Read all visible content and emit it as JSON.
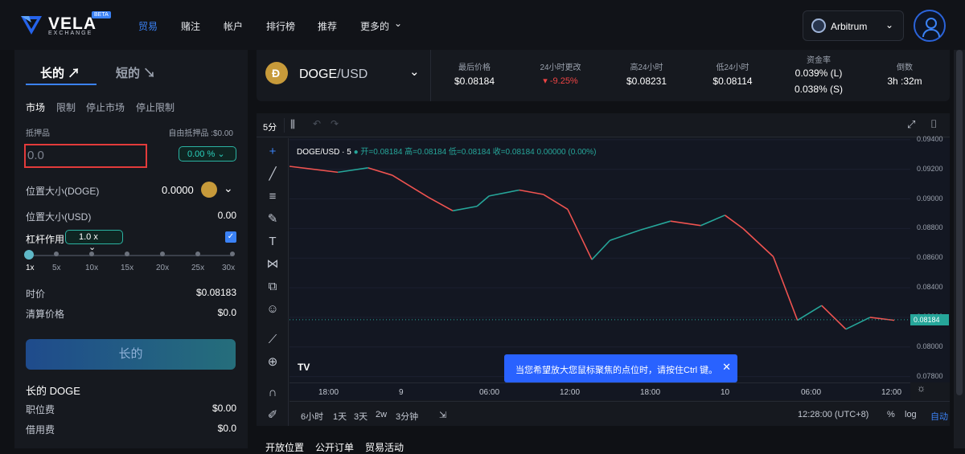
{
  "brand": {
    "name": "VELA",
    "sub": "EXCHANGE",
    "badge": "BETA"
  },
  "nav": [
    "贸易",
    "赌注",
    "帐户",
    "排行榜",
    "推荐",
    "更多的"
  ],
  "network": {
    "label": "Arbitrum"
  },
  "order": {
    "tab_long": "长的",
    "tab_short": "短的",
    "types": [
      "市场",
      "限制",
      "停止市场",
      "停止限制"
    ],
    "collateral_label": "抵押品",
    "free_collateral": "自由抵押品 :$0.00",
    "amount_placeholder": "0.0",
    "pct_value": "0.00 %",
    "pos_size_label": "位置大小(DOGE)",
    "pos_size_value": "0.0000",
    "pos_usd_label": "位置大小(USD)",
    "pos_usd_value": "0.00",
    "leverage_label": "杠杆作用",
    "leverage_value": "1.0 x",
    "leverage_ticks": [
      "1x",
      "5x",
      "10x",
      "15x",
      "20x",
      "25x",
      "30x"
    ],
    "price_label": "时价",
    "price_value": "$0.08183",
    "liq_label": "清算价格",
    "liq_value": "$0.0",
    "submit_label": "长的",
    "summary_title": "长的 DOGE",
    "fee1_label": "职位费",
    "fee1_value": "$0.00",
    "fee2_label": "借用费",
    "fee2_value": "$0.0"
  },
  "market": {
    "pair_base": "DOGE",
    "pair_quote": "/USD",
    "stats": [
      {
        "label": "最后价格",
        "value": "$0.08184"
      },
      {
        "label": "24小时更改",
        "value": "▾ -9.25%"
      },
      {
        "label": "高24小时",
        "value": "$0.08231"
      },
      {
        "label": "低24小时",
        "value": "$0.08114"
      },
      {
        "label": "资金率",
        "value": "0.039% (L)",
        "value2": "0.038% (S)"
      },
      {
        "label": "倒数",
        "value": "3h :32m"
      }
    ]
  },
  "chart_toolbar": {
    "interval": "5分"
  },
  "legend": {
    "symbol": "DOGE/USD · 5",
    "ohlc": "开=0.08184 高=0.08184 低=0.08184 收=0.08184 0.00000 (0.00%)"
  },
  "chart_data": {
    "type": "line",
    "title": "DOGE/USD · 5",
    "ylim": [
      0.0776,
      0.0941
    ],
    "yticks": [
      "0.09400",
      "0.09200",
      "0.09000",
      "0.08800",
      "0.08600",
      "0.08400",
      "0.08200",
      "0.08000",
      "0.07800"
    ],
    "current": "0.08184",
    "xticks": [
      "18:00",
      "9",
      "06:00",
      "12:00",
      "18:00",
      "10",
      "06:00",
      "12:00"
    ],
    "series": [
      {
        "x": [
          0,
          8,
          13,
          17,
          23,
          27,
          31,
          33,
          38,
          42,
          46,
          50,
          53,
          58,
          63,
          68,
          72,
          75,
          80,
          84,
          88,
          92,
          96,
          100
        ],
        "values": [
          0.0922,
          0.0918,
          0.0921,
          0.0916,
          0.0901,
          0.0892,
          0.0895,
          0.0902,
          0.0906,
          0.0903,
          0.0893,
          0.0859,
          0.0872,
          0.0879,
          0.0885,
          0.0882,
          0.0889,
          0.088,
          0.0861,
          0.0818,
          0.0828,
          0.0812,
          0.082,
          0.0818
        ]
      }
    ]
  },
  "bottom": {
    "ranges": [
      "6小时",
      "1天",
      "3天",
      "2w",
      "3分钟"
    ],
    "time": "12:28:00 (UTC+8)",
    "pct": "%",
    "log": "log",
    "auto": "自动"
  },
  "toast": "当您希望放大您鼠标聚焦的点位时，请按住Ctrl 键。",
  "bottom_tabs": [
    "开放位置",
    "公开订单",
    "贸易活动"
  ]
}
